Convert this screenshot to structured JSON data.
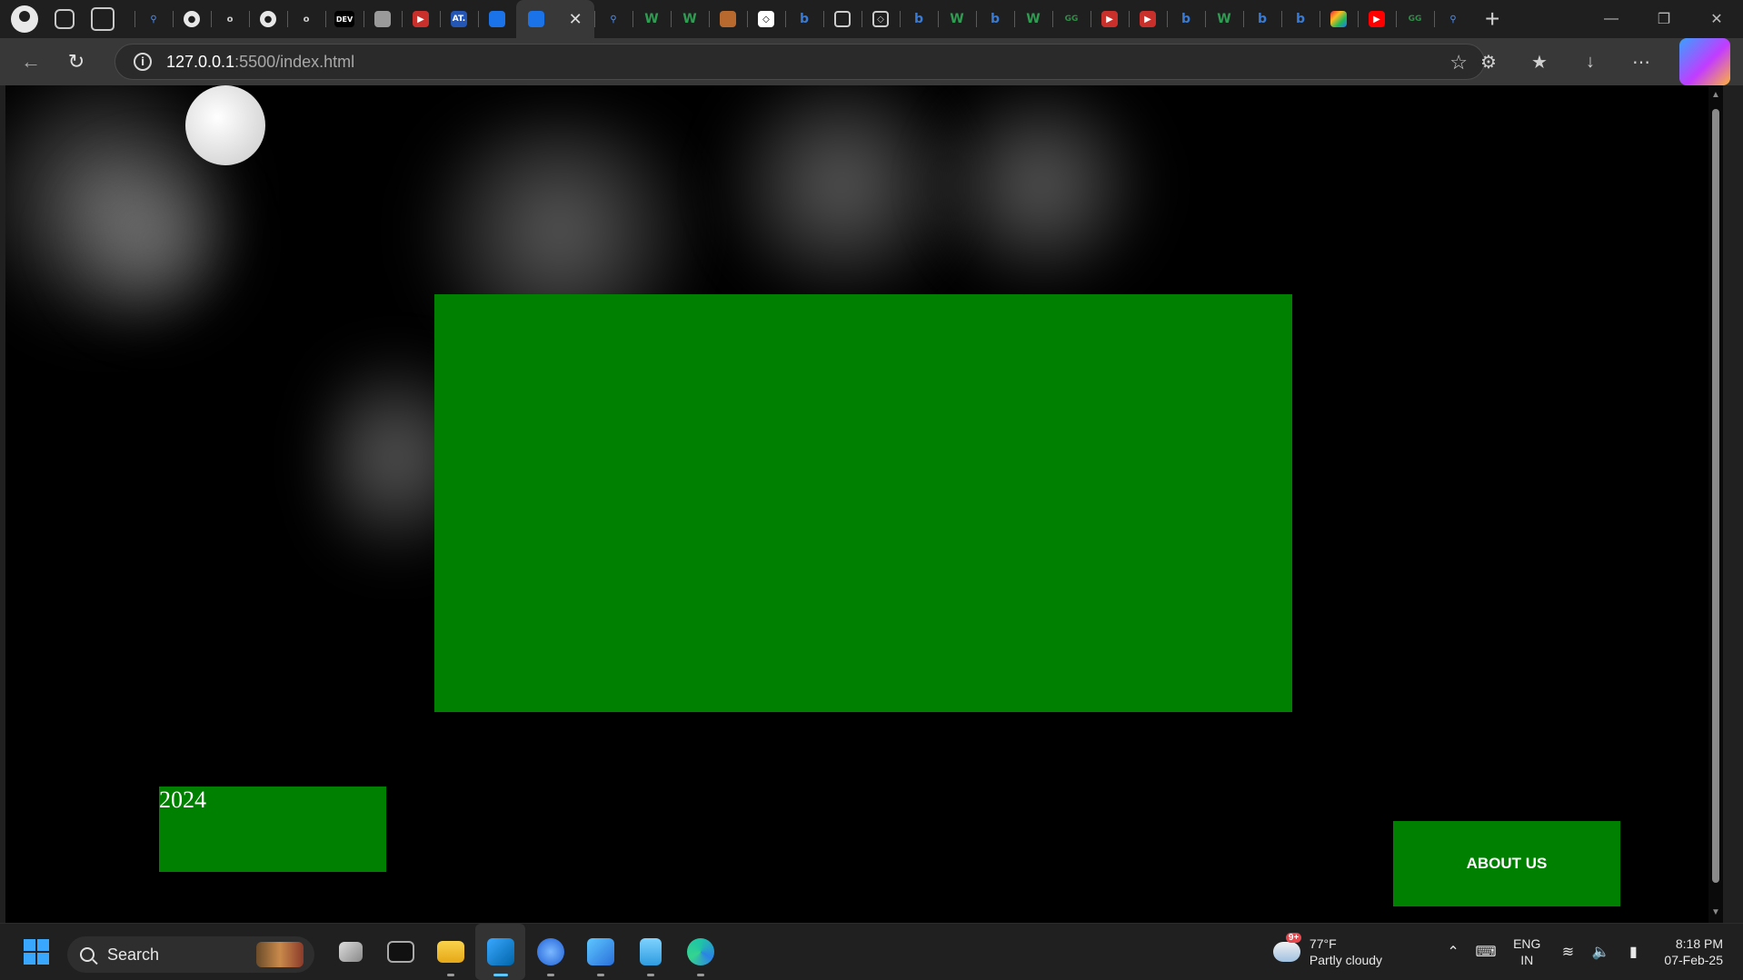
{
  "browser": {
    "tab_favicons": [
      "search-icon",
      "github-icon",
      "o-icon",
      "github-icon",
      "o-icon",
      "dev-icon",
      "newspaper-icon",
      "youtube-icon",
      "at-icon",
      "blog-icon",
      "search-icon",
      "w-icon",
      "w-icon",
      "draw-icon",
      "codepen-icon",
      "bing-icon",
      "frame-icon",
      "codepen-icon",
      "bing-icon",
      "w-icon",
      "bing-icon",
      "w-icon",
      "gfg-icon",
      "youtube-icon",
      "youtube-icon",
      "bing-icon",
      "w-icon",
      "bing-icon",
      "bing-icon",
      "colorful-icon",
      "youtube-icon",
      "gfg-icon",
      "search-icon"
    ],
    "active_tab_favicon": "blog-icon",
    "dev_label": "DEV",
    "at_label": "AT.",
    "url_host": "127.0.0.1",
    "url_rest": ":5500/index.html",
    "colors": {
      "tabstrip": "#1f1f1f",
      "toolbar": "#383838"
    }
  },
  "page": {
    "year": "2024",
    "about_button": "ABOUT US",
    "colors": {
      "background": "#000000",
      "box": "#008000",
      "moon": "#e8e8e8"
    }
  },
  "taskbar": {
    "search_label": "Search",
    "weather": {
      "badge": "9+",
      "temperature": "77°F",
      "condition": "Partly cloudy"
    },
    "language": {
      "line1": "ENG",
      "line2": "IN"
    },
    "clock": {
      "time": "8:18 PM",
      "date": "07-Feb-25"
    },
    "apps": [
      "task-view-icon",
      "terminal-icon",
      "file-explorer-icon",
      "vscode-icon",
      "firefox-icon",
      "paint-icon",
      "notepad-icon",
      "edge-icon"
    ]
  }
}
